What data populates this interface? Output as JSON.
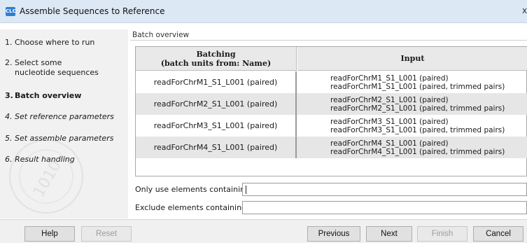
{
  "window": {
    "app_icon": "CLC",
    "title": "Assemble Sequences to Reference",
    "close_glyph": "x"
  },
  "sidebar": {
    "steps": [
      {
        "num": "1.",
        "label": "Choose where to run",
        "state": "done"
      },
      {
        "num": "2.",
        "label": "Select some nucleotide sequences",
        "state": "done"
      },
      {
        "num": "3.",
        "label": "Batch overview",
        "state": "current"
      },
      {
        "num": "4.",
        "label": "Set reference parameters",
        "state": "future"
      },
      {
        "num": "5.",
        "label": "Set assemble parameters",
        "state": "future"
      },
      {
        "num": "6.",
        "label": "Result handling",
        "state": "future"
      }
    ]
  },
  "main": {
    "section_title": "Batch overview",
    "table": {
      "headers": {
        "batching_line1": "Batching",
        "batching_line2": "(batch units from: Name)",
        "input": "Input"
      },
      "rows": [
        {
          "batch": "readForChrM1_S1_L001 (paired)",
          "inputs": [
            "readForChrM1_S1_L001 (paired)",
            "readForChrM1_S1_L001 (paired, trimmed pairs)"
          ]
        },
        {
          "batch": "readForChrM2_S1_L001 (paired)",
          "inputs": [
            "readForChrM2_S1_L001 (paired)",
            "readForChrM2_S1_L001 (paired, trimmed pairs)"
          ]
        },
        {
          "batch": "readForChrM3_S1_L001 (paired)",
          "inputs": [
            "readForChrM3_S1_L001 (paired)",
            "readForChrM3_S1_L001 (paired, trimmed pairs)"
          ]
        },
        {
          "batch": "readForChrM4_S1_L001 (paired)",
          "inputs": [
            "readForChrM4_S1_L001 (paired)",
            "readForChrM4_S1_L001 (paired, trimmed pairs)"
          ]
        }
      ]
    },
    "filters": {
      "only_use_label": "Only use elements containing:",
      "only_use_value": "",
      "exclude_label": "Exclude elements containing:",
      "exclude_value": ""
    }
  },
  "footer": {
    "help": "Help",
    "reset": "Reset",
    "previous": "Previous",
    "next": "Next",
    "finish": "Finish",
    "cancel": "Cancel"
  }
}
